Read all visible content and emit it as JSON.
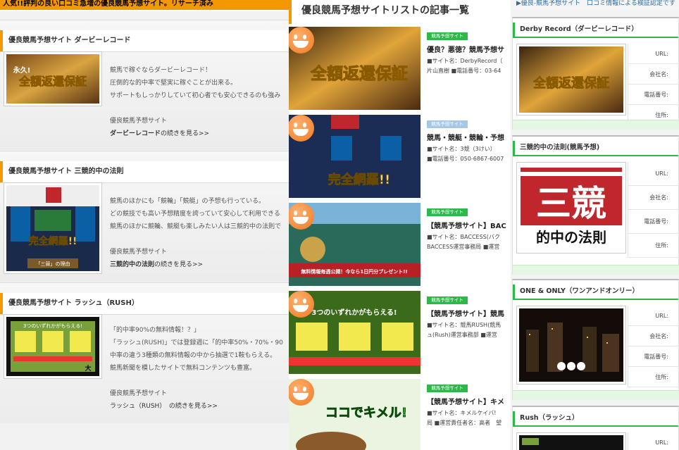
{
  "left": {
    "top_banner": "人気!!評判の良い口コミ急増の優良競馬予想サイト。リサーチ済み",
    "cards": [
      {
        "heading": "優良競馬予想サイト ダービーレコード",
        "img_label": "全額返還保証",
        "img_label2": "永久!",
        "line1_pre": "競馬で稼ぐならダービーレコード！",
        "line2": "圧倒的な的中率で堅実に稼ぐことが出来る。",
        "line3": "サポートもしっかりしていて初心者でも安心できるのも強み",
        "category": "優良競馬予想サイト",
        "more_name": "ダービーレコード",
        "more_suffix": "の続きを見る>>"
      },
      {
        "heading": "優良競馬予想サイト 三競的中の法則",
        "img_label": "完全網羅!!",
        "img_label2": "「三競」の理由",
        "line1_pre": "競馬のほかにも「競輪」「競艇」の予想も行っている。",
        "line2": "どの競技でも高い予想精度を誇っていて安心して利用できる",
        "line3": "競馬のほかに競輪、競艇も楽しみたい人は三競的中の法則で",
        "category": "優良競馬予想サイト",
        "more_name": "三競的中の法則",
        "more_suffix": "の続きを見る>>"
      },
      {
        "heading": "優良競馬予想サイト ラッシュ（RUSH）",
        "img_label": "3つのいずれかがもらえる!",
        "img_label2": "大",
        "line1_pre": "「的中率90%の無料情報！？」",
        "line2": "「ラッシュ(RUSH)」では登録週に「的中率50%・70%・90",
        "line3": "中率の違う3種類の無料情報の中から抽選で1鞍もらえる。",
        "line4": "競馬新聞を模したサイトで無料コンテンツも豊富。",
        "category": "優良競馬予想サイト",
        "more_name": "ラッシュ（RUSH）",
        "more_suffix": "　の続きを見る>>"
      }
    ]
  },
  "middle": {
    "title": "優良競馬予想サイトリストの記事一覧",
    "items": [
      {
        "badge": "競馬予想サイト",
        "title": "優良？悪徳？競馬予想サ",
        "meta1": "■サイト名：DerbyRecord（",
        "meta2": "片山直樹 ■電話番号：03-64",
        "img": "全額返還保証"
      },
      {
        "badge": "競馬予想サイト",
        "title": "競馬・競艇・競輪・予想",
        "meta1": "■サイト名：3競（3けい）",
        "meta2": "■電話番号：050-6867-6007",
        "img": "完全網羅!!"
      },
      {
        "badge": "競馬予想サイト",
        "title": "【競馬予想サイト】BAC",
        "meta1": "■サイト名：BACCESS(バク",
        "meta2": "BACCESS運営事務局 ■運営",
        "img": "無料情報毎週公開！今なら1日円分プレゼント!!"
      },
      {
        "badge": "競馬予想サイト",
        "title": "【競馬予想サイト】競馬",
        "meta1": "■サイト名：競馬RUSH(競馬",
        "meta2": "ュ(Rush)運営事務部 ■運営",
        "img": "3つのいずれかがもらえる!"
      },
      {
        "badge": "競馬予想サイト",
        "title": "【競馬予想サイト】キメ",
        "meta1": "■サイト名：キメルケイバ!",
        "meta2": "局 ■運営責任者名：高者　望",
        "img": "ココでキメル!"
      }
    ]
  },
  "right": {
    "breadcrumb": "▶優良-競馬予想サイト　口コミ情報による検証認定です",
    "cards": [
      {
        "heading": "Derby Record（ダービーレコード）",
        "fields": [
          "URL:",
          "会社名:",
          "電話番号:",
          "住所:"
        ]
      },
      {
        "heading": "三競的中の法則(競馬予想)",
        "fields": [
          "URL:",
          "会社名:",
          "電話番号:",
          "住所:"
        ],
        "logo_big": "三競",
        "logo_sub": "的中の法則"
      },
      {
        "heading": "ONE & ONLY（ワンアンドオンリー）",
        "fields": [
          "URL:",
          "会社名:",
          "電話番号:",
          "住所:"
        ]
      },
      {
        "heading": "Rush（ラッシュ）",
        "fields": [
          "URL:"
        ]
      }
    ]
  }
}
